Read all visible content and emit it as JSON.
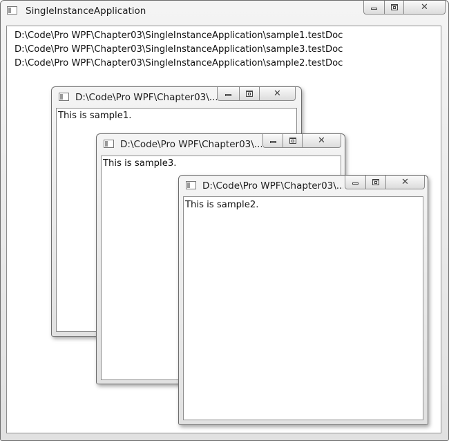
{
  "main_window": {
    "title": "SingleInstanceApplication",
    "document_list": [
      "D:\\Code\\Pro WPF\\Chapter03\\SingleInstanceApplication\\sample1.testDoc",
      "D:\\Code\\Pro WPF\\Chapter03\\SingleInstanceApplication\\sample3.testDoc",
      "D:\\Code\\Pro WPF\\Chapter03\\SingleInstanceApplication\\sample2.testDoc"
    ]
  },
  "document_windows": [
    {
      "title": "D:\\Code\\Pro WPF\\Chapter03\\...",
      "content": "This is sample1."
    },
    {
      "title": "D:\\Code\\Pro WPF\\Chapter03\\...",
      "content": "This is sample3."
    },
    {
      "title": "D:\\Code\\Pro WPF\\Chapter03\\...",
      "content": "This is sample2."
    }
  ],
  "icons": {
    "app": "app-window-icon",
    "minimize": "minimize-icon",
    "maximize": "maximize-icon",
    "close": "close-icon"
  }
}
